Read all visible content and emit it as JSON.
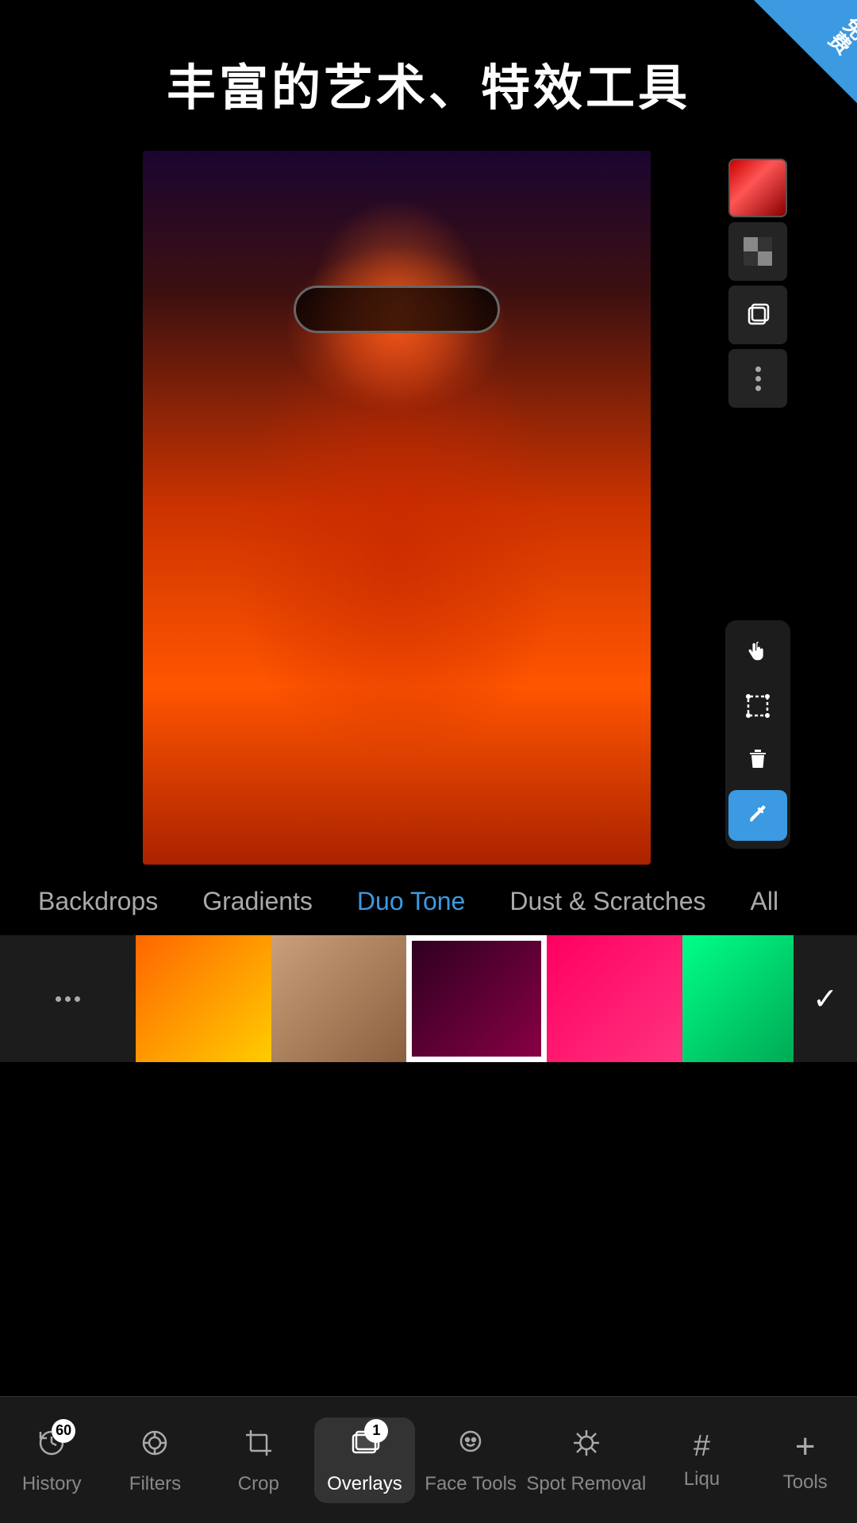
{
  "title": "丰富的艺术、特效工具",
  "badge_text": "免费",
  "top_toolbar": {
    "color_swatch": "red-gradient",
    "icons": [
      {
        "name": "checkerboard",
        "symbol": "▦"
      },
      {
        "name": "duplicate",
        "symbol": "⧉"
      },
      {
        "name": "more",
        "symbol": "⋮"
      }
    ]
  },
  "right_toolbar_bottom": [
    {
      "name": "hand",
      "symbol": "✋",
      "active": false
    },
    {
      "name": "transform",
      "symbol": "⊞",
      "active": false
    },
    {
      "name": "delete",
      "symbol": "🗑",
      "active": false
    },
    {
      "name": "eyedropper",
      "symbol": "💉",
      "active": true
    }
  ],
  "category_tabs": [
    {
      "label": "Backdrops",
      "active": false
    },
    {
      "label": "Gradients",
      "active": false
    },
    {
      "label": "Duo Tone",
      "active": true
    },
    {
      "label": "Dust & Scratches",
      "active": false
    },
    {
      "label": "All",
      "active": false
    }
  ],
  "swatches": [
    {
      "id": "menu",
      "type": "menu"
    },
    {
      "id": "orange",
      "color": "#ff8800",
      "gradient": "linear-gradient(135deg,#ff6600,#ffcc00)"
    },
    {
      "id": "tan",
      "color": "#b8906a",
      "gradient": "linear-gradient(135deg,#c9a07a,#8b6040)"
    },
    {
      "id": "darkred",
      "color": "#6a0030",
      "gradient": "linear-gradient(135deg,#3d0025,#9a0050)",
      "selected": true
    },
    {
      "id": "hotpink",
      "color": "#ff1060",
      "gradient": "linear-gradient(135deg,#ff0050,#ff4090)"
    },
    {
      "id": "greenteal",
      "color": "#00cc88",
      "gradient": "linear-gradient(135deg,#00ff88,#00aa55)"
    }
  ],
  "bottom_nav": [
    {
      "id": "history",
      "label": "History",
      "icon": "↺",
      "badge": "60",
      "active": false
    },
    {
      "id": "filters",
      "label": "Filters",
      "icon": "◎",
      "active": false
    },
    {
      "id": "crop",
      "label": "Crop",
      "icon": "⊡",
      "active": false
    },
    {
      "id": "overlays",
      "label": "Overlays",
      "icon": "◈",
      "badge": "1",
      "active": true
    },
    {
      "id": "facetools",
      "label": "Face Tools",
      "icon": "☺",
      "active": false
    },
    {
      "id": "spotremoval",
      "label": "Spot Removal",
      "icon": "✦",
      "active": false
    },
    {
      "id": "liqu",
      "label": "Liqu",
      "icon": "#",
      "active": false
    },
    {
      "id": "tools",
      "label": "Tools",
      "icon": "+",
      "active": false
    }
  ]
}
